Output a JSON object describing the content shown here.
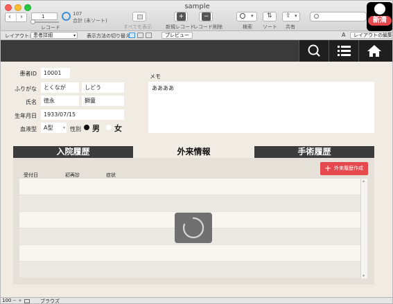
{
  "window": {
    "title": "sample"
  },
  "toolbar": {
    "record_value": "1",
    "record_label": "レコード",
    "total_count": "107",
    "total_label": "合計 (未ソート)",
    "show_all_label": "すべてを表示",
    "new_record_label": "新規レコード",
    "delete_record_label": "レコード削除",
    "find_label": "検索",
    "sort_label": "ソート",
    "share_label": "共有"
  },
  "layoutbar": {
    "layout_label": "レイアウト:",
    "layout_value": "患者詳細",
    "view_as_label": "表示方法の切り替え:",
    "preview_label": "プレビュー",
    "edit_layout_label": "レイアウトの編集",
    "font_size_glyph": "A"
  },
  "badge": {
    "text": "新清"
  },
  "form": {
    "patient_id_label": "患者ID",
    "patient_id": "10001",
    "furigana_label": "ふりがな",
    "furigana_last": "とくなが",
    "furigana_first": "しどう",
    "name_label": "氏名",
    "name_last": "徳永",
    "name_first": "獅童",
    "birthdate_label": "生年月日",
    "birthdate": "1933/07/15",
    "blood_type_label": "血液型",
    "blood_type": "A型",
    "sex_label": "性別",
    "sex_male": "男",
    "sex_female": "女",
    "memo_label": "メモ",
    "memo_value": "ああああ"
  },
  "tabs": {
    "inpatient": "入院履歴",
    "outpatient": "外来情報",
    "surgery": "手術履歴"
  },
  "outpatient": {
    "add_button": "外来履歴作成",
    "columns": [
      "受付日",
      "初再診",
      "症状"
    ]
  },
  "statusbar": {
    "zoom": "100",
    "mode": "ブラウズ"
  },
  "colors": {
    "dark_bar": "#3a3a3a",
    "tab_dark": "#3b3b3b",
    "accent_red": "#e5484d",
    "background": "#f0ece4"
  }
}
